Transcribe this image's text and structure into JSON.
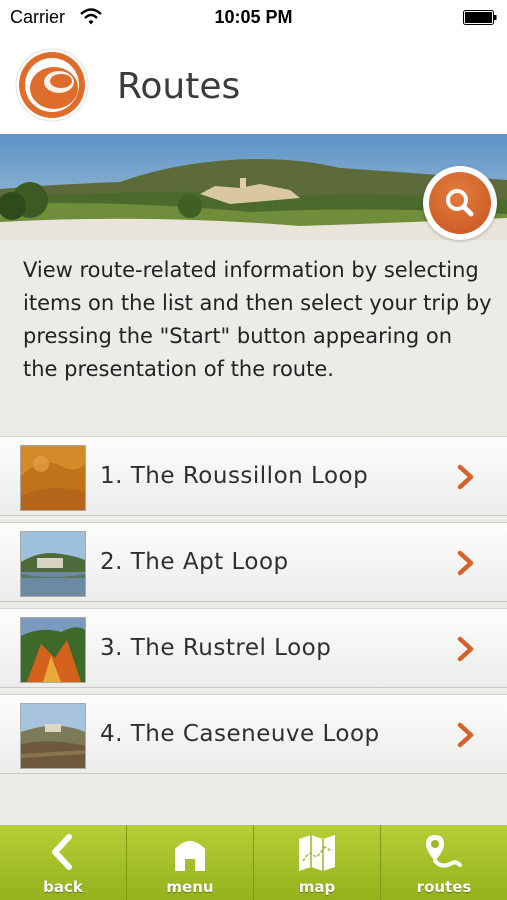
{
  "status_bar": {
    "carrier": "Carrier",
    "time": "10:05 PM"
  },
  "header": {
    "title": "Routes"
  },
  "intro_text": "View route-related information by selecting items on the list and then select your trip by pressing the \"Start\" button appearing on the presentation of the route.",
  "routes": [
    {
      "label": "1. The Roussillon Loop"
    },
    {
      "label": "2. The Apt Loop"
    },
    {
      "label": "3. The Rustrel Loop"
    },
    {
      "label": "4. The Caseneuve Loop"
    }
  ],
  "tabbar": {
    "back": "back",
    "menu": "menu",
    "map": "map",
    "routes": "routes"
  },
  "icons": {
    "search": "search-icon",
    "chevron": "chevron-right-icon",
    "logo": "app-logo"
  },
  "colors": {
    "accent": "#d4622a",
    "tabbar": "#a6c22a"
  }
}
